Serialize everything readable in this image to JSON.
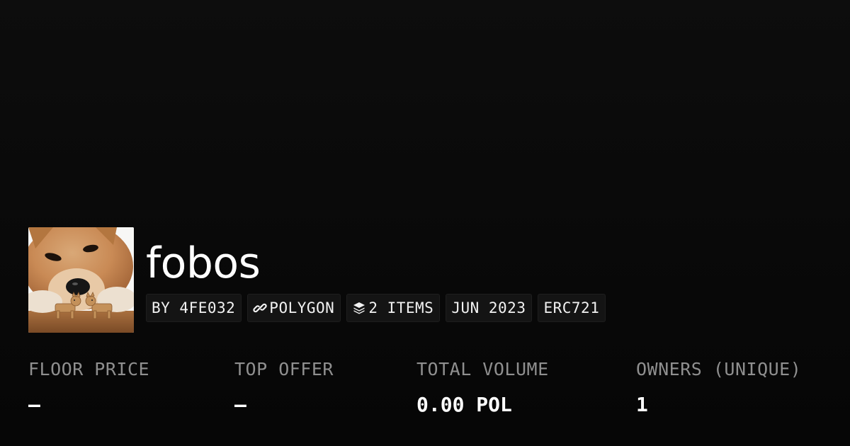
{
  "collection": {
    "name": "fobos",
    "avatar_alt": "Shiba dog with two small toy dog figurines"
  },
  "chips": {
    "creator": "BY 4FE032",
    "chain": "POLYGON",
    "chain_icon": "chain-link-icon",
    "items": "2 ITEMS",
    "items_icon": "layers-icon",
    "created": "JUN 2023",
    "standard": "ERC721"
  },
  "stats": {
    "floor_price": {
      "label": "FLOOR PRICE",
      "value": "—"
    },
    "top_offer": {
      "label": "TOP OFFER",
      "value": "—"
    },
    "total_volume": {
      "label": "TOTAL VOLUME",
      "value": "0.00 POL"
    },
    "owners": {
      "label": "OWNERS (UNIQUE)",
      "value": "1"
    }
  },
  "colors": {
    "background": "#0a0a0a",
    "chip_background": "#141414",
    "label_gray": "#8f8f8f",
    "text_white": "#ffffff"
  }
}
